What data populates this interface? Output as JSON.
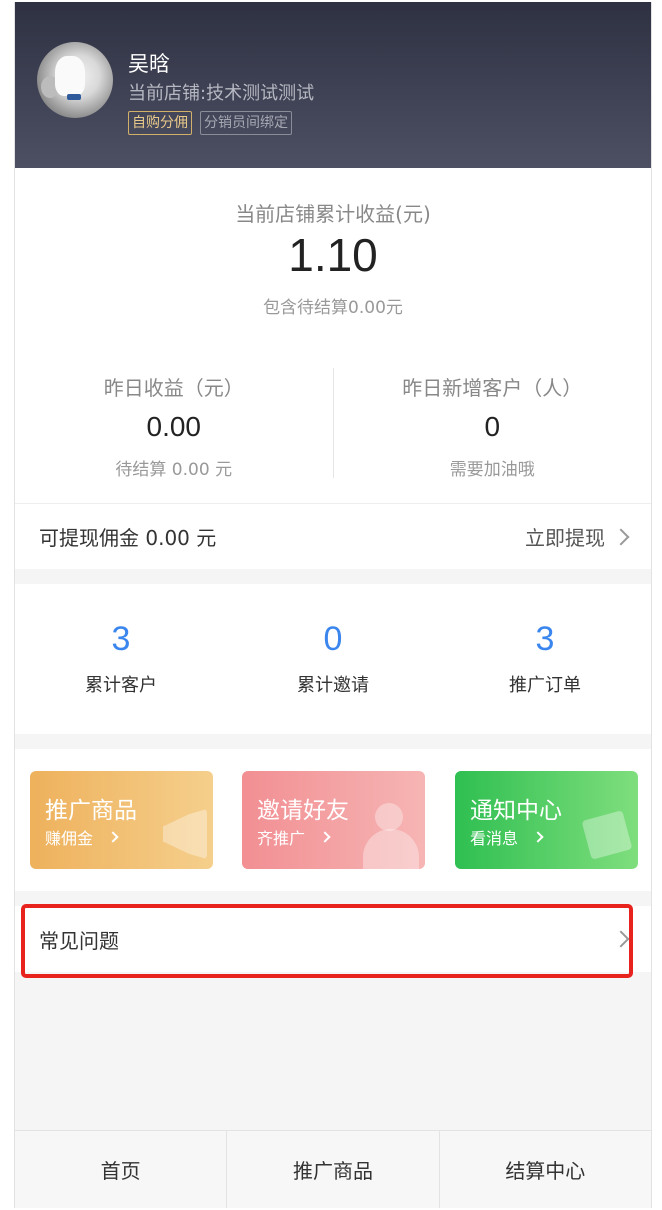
{
  "header": {
    "username": "吴晗",
    "store_label": "当前店铺:技术测试测试",
    "tags": [
      "自购分佣",
      "分销员间绑定"
    ]
  },
  "earnings": {
    "title": "当前店铺累计收益(元)",
    "amount": "1.10",
    "pending": "包含待结算0.00元",
    "yesterday_income": {
      "label": "昨日收益（元）",
      "value": "0.00",
      "sub": "待结算 0.00 元"
    },
    "yesterday_customers": {
      "label": "昨日新增客户（人）",
      "value": "0",
      "sub": "需要加油哦"
    }
  },
  "withdraw": {
    "label": "可提现佣金 0.00 元",
    "action": "立即提现"
  },
  "stats": [
    {
      "value": "3",
      "label": "累计客户"
    },
    {
      "value": "0",
      "label": "累计邀请"
    },
    {
      "value": "3",
      "label": "推广订单"
    }
  ],
  "cards": [
    {
      "title": "推广商品",
      "sub": "赚佣金",
      "icon": "megaphone-icon",
      "color": "#eeb15c"
    },
    {
      "title": "邀请好友",
      "sub": "齐推广",
      "icon": "person-icon",
      "color": "#f28f93"
    },
    {
      "title": "通知中心",
      "sub": "看消息",
      "icon": "chat-icon",
      "color": "#2fbf51"
    }
  ],
  "faq": {
    "label": "常见问题"
  },
  "nav": [
    {
      "label": "首页"
    },
    {
      "label": "推广商品"
    },
    {
      "label": "结算中心"
    }
  ],
  "colors": {
    "accent": "#3a86ee",
    "header": "#2e3142",
    "highlight": "#e8231e"
  }
}
